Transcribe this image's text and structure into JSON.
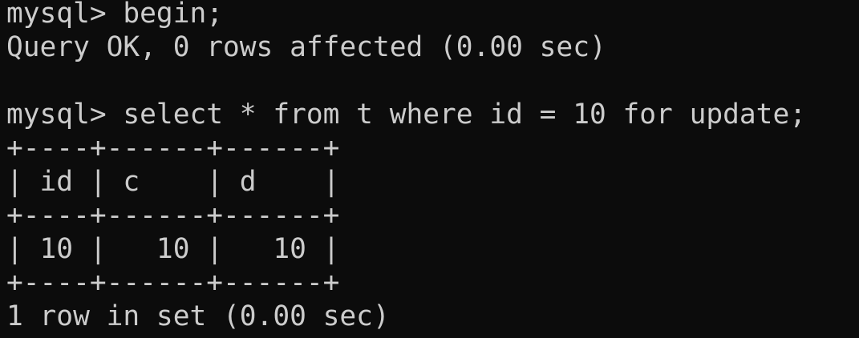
{
  "terminal": {
    "lines": [
      "mysql> begin;",
      "Query OK, 0 rows affected (0.00 sec)",
      "",
      "mysql> select * from t where id = 10 for update;",
      "+----+------+------+",
      "| id | c    | d    |",
      "+----+------+------+",
      "| 10 |   10 |   10 |",
      "+----+------+------+",
      "1 row in set (0.00 sec)"
    ]
  }
}
